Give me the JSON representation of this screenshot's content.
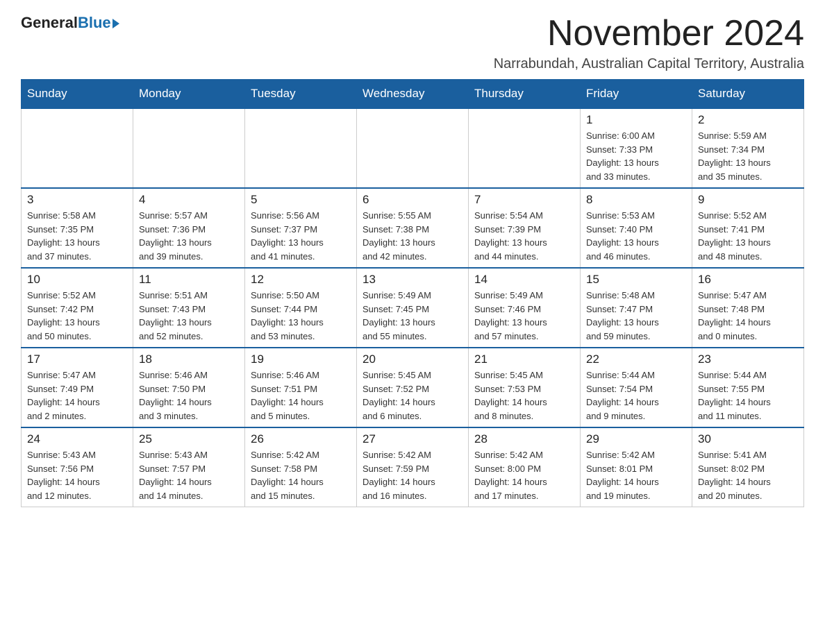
{
  "logo": {
    "general": "General",
    "blue": "Blue"
  },
  "title": "November 2024",
  "subtitle": "Narrabundah, Australian Capital Territory, Australia",
  "days_of_week": [
    "Sunday",
    "Monday",
    "Tuesday",
    "Wednesday",
    "Thursday",
    "Friday",
    "Saturday"
  ],
  "weeks": [
    [
      {
        "day": "",
        "info": ""
      },
      {
        "day": "",
        "info": ""
      },
      {
        "day": "",
        "info": ""
      },
      {
        "day": "",
        "info": ""
      },
      {
        "day": "",
        "info": ""
      },
      {
        "day": "1",
        "info": "Sunrise: 6:00 AM\nSunset: 7:33 PM\nDaylight: 13 hours\nand 33 minutes."
      },
      {
        "day": "2",
        "info": "Sunrise: 5:59 AM\nSunset: 7:34 PM\nDaylight: 13 hours\nand 35 minutes."
      }
    ],
    [
      {
        "day": "3",
        "info": "Sunrise: 5:58 AM\nSunset: 7:35 PM\nDaylight: 13 hours\nand 37 minutes."
      },
      {
        "day": "4",
        "info": "Sunrise: 5:57 AM\nSunset: 7:36 PM\nDaylight: 13 hours\nand 39 minutes."
      },
      {
        "day": "5",
        "info": "Sunrise: 5:56 AM\nSunset: 7:37 PM\nDaylight: 13 hours\nand 41 minutes."
      },
      {
        "day": "6",
        "info": "Sunrise: 5:55 AM\nSunset: 7:38 PM\nDaylight: 13 hours\nand 42 minutes."
      },
      {
        "day": "7",
        "info": "Sunrise: 5:54 AM\nSunset: 7:39 PM\nDaylight: 13 hours\nand 44 minutes."
      },
      {
        "day": "8",
        "info": "Sunrise: 5:53 AM\nSunset: 7:40 PM\nDaylight: 13 hours\nand 46 minutes."
      },
      {
        "day": "9",
        "info": "Sunrise: 5:52 AM\nSunset: 7:41 PM\nDaylight: 13 hours\nand 48 minutes."
      }
    ],
    [
      {
        "day": "10",
        "info": "Sunrise: 5:52 AM\nSunset: 7:42 PM\nDaylight: 13 hours\nand 50 minutes."
      },
      {
        "day": "11",
        "info": "Sunrise: 5:51 AM\nSunset: 7:43 PM\nDaylight: 13 hours\nand 52 minutes."
      },
      {
        "day": "12",
        "info": "Sunrise: 5:50 AM\nSunset: 7:44 PM\nDaylight: 13 hours\nand 53 minutes."
      },
      {
        "day": "13",
        "info": "Sunrise: 5:49 AM\nSunset: 7:45 PM\nDaylight: 13 hours\nand 55 minutes."
      },
      {
        "day": "14",
        "info": "Sunrise: 5:49 AM\nSunset: 7:46 PM\nDaylight: 13 hours\nand 57 minutes."
      },
      {
        "day": "15",
        "info": "Sunrise: 5:48 AM\nSunset: 7:47 PM\nDaylight: 13 hours\nand 59 minutes."
      },
      {
        "day": "16",
        "info": "Sunrise: 5:47 AM\nSunset: 7:48 PM\nDaylight: 14 hours\nand 0 minutes."
      }
    ],
    [
      {
        "day": "17",
        "info": "Sunrise: 5:47 AM\nSunset: 7:49 PM\nDaylight: 14 hours\nand 2 minutes."
      },
      {
        "day": "18",
        "info": "Sunrise: 5:46 AM\nSunset: 7:50 PM\nDaylight: 14 hours\nand 3 minutes."
      },
      {
        "day": "19",
        "info": "Sunrise: 5:46 AM\nSunset: 7:51 PM\nDaylight: 14 hours\nand 5 minutes."
      },
      {
        "day": "20",
        "info": "Sunrise: 5:45 AM\nSunset: 7:52 PM\nDaylight: 14 hours\nand 6 minutes."
      },
      {
        "day": "21",
        "info": "Sunrise: 5:45 AM\nSunset: 7:53 PM\nDaylight: 14 hours\nand 8 minutes."
      },
      {
        "day": "22",
        "info": "Sunrise: 5:44 AM\nSunset: 7:54 PM\nDaylight: 14 hours\nand 9 minutes."
      },
      {
        "day": "23",
        "info": "Sunrise: 5:44 AM\nSunset: 7:55 PM\nDaylight: 14 hours\nand 11 minutes."
      }
    ],
    [
      {
        "day": "24",
        "info": "Sunrise: 5:43 AM\nSunset: 7:56 PM\nDaylight: 14 hours\nand 12 minutes."
      },
      {
        "day": "25",
        "info": "Sunrise: 5:43 AM\nSunset: 7:57 PM\nDaylight: 14 hours\nand 14 minutes."
      },
      {
        "day": "26",
        "info": "Sunrise: 5:42 AM\nSunset: 7:58 PM\nDaylight: 14 hours\nand 15 minutes."
      },
      {
        "day": "27",
        "info": "Sunrise: 5:42 AM\nSunset: 7:59 PM\nDaylight: 14 hours\nand 16 minutes."
      },
      {
        "day": "28",
        "info": "Sunrise: 5:42 AM\nSunset: 8:00 PM\nDaylight: 14 hours\nand 17 minutes."
      },
      {
        "day": "29",
        "info": "Sunrise: 5:42 AM\nSunset: 8:01 PM\nDaylight: 14 hours\nand 19 minutes."
      },
      {
        "day": "30",
        "info": "Sunrise: 5:41 AM\nSunset: 8:02 PM\nDaylight: 14 hours\nand 20 minutes."
      }
    ]
  ]
}
